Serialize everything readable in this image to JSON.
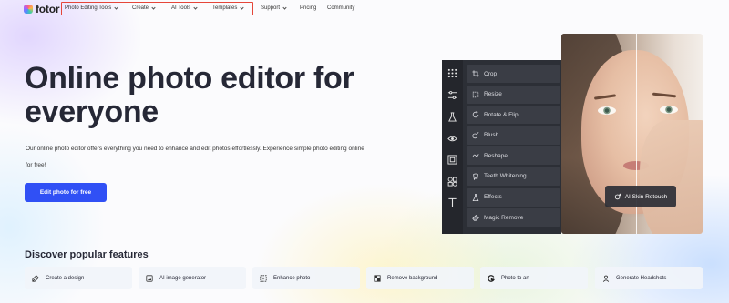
{
  "nav": {
    "logo": "fotor",
    "items": [
      {
        "label": "Photo Editing Tools",
        "dropdown": true
      },
      {
        "label": "Create",
        "dropdown": true
      },
      {
        "label": "AI Tools",
        "dropdown": true
      },
      {
        "label": "Templates",
        "dropdown": true
      },
      {
        "label": "Support",
        "dropdown": true
      },
      {
        "label": "Pricing",
        "dropdown": false
      },
      {
        "label": "Community",
        "dropdown": false
      }
    ],
    "highlight_color": "#e5463a"
  },
  "hero": {
    "title_line1": "Online photo editor for",
    "title_line2": "everyone",
    "description": "Our online photo editor offers everything you need to enhance and edit photos effortlessly. Experience simple photo editing online for free!",
    "cta_label": "Edit photo for free",
    "cta_color": "#3050f5"
  },
  "editor_preview": {
    "rail_icons": [
      "grid-icon",
      "sliders-icon",
      "flask-icon",
      "eye-icon",
      "frame-icon",
      "shapes-icon",
      "text-icon"
    ],
    "tools": [
      {
        "label": "Crop",
        "icon": "crop-icon"
      },
      {
        "label": "Resize",
        "icon": "resize-icon"
      },
      {
        "label": "Rotate & Flip",
        "icon": "rotate-icon"
      },
      {
        "label": "Blush",
        "icon": "blush-icon"
      },
      {
        "label": "Reshape",
        "icon": "reshape-icon"
      },
      {
        "label": "Teeth Whitening",
        "icon": "teeth-icon"
      },
      {
        "label": "Effects",
        "icon": "effects-icon"
      },
      {
        "label": "Magic Remove",
        "icon": "eraser-icon"
      }
    ],
    "badge_label": "AI Skin Retouch"
  },
  "features": {
    "title": "Discover popular features",
    "items": [
      {
        "label": "Create a design",
        "icon": "design-icon"
      },
      {
        "label": "AI image generator",
        "icon": "ai-image-icon"
      },
      {
        "label": "Enhance photo",
        "icon": "enhance-icon"
      },
      {
        "label": "Remove background",
        "icon": "remove-bg-icon"
      },
      {
        "label": "Photo to art",
        "icon": "art-icon"
      },
      {
        "label": "Generate Headshots",
        "icon": "headshot-icon"
      }
    ]
  }
}
